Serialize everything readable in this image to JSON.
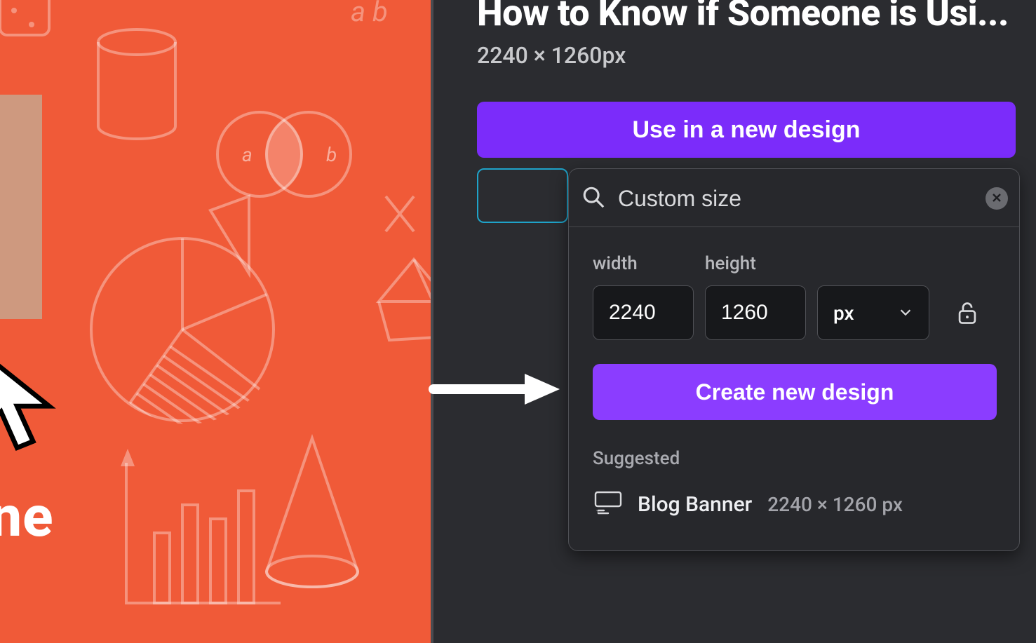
{
  "canvas": {
    "partial_word": "one"
  },
  "panel": {
    "title": "How to Know if Someone is Usi...",
    "dimensions": "2240 × 1260px",
    "use_button": "Use in a new design"
  },
  "popover": {
    "search_value": "Custom size",
    "width_label": "width",
    "height_label": "height",
    "width_value": "2240",
    "height_value": "1260",
    "unit": "px",
    "create_button": "Create new design",
    "suggested_label": "Suggested",
    "suggested": {
      "name": "Blog Banner",
      "dims": "2240 × 1260 px"
    }
  }
}
